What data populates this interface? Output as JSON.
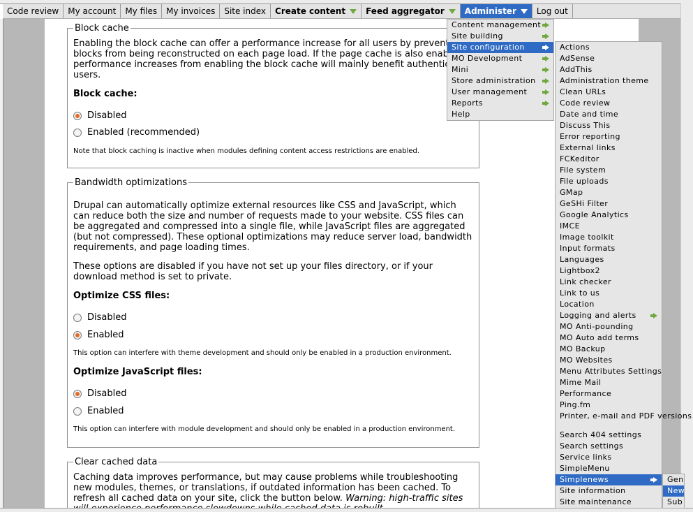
{
  "topbar": {
    "items": [
      {
        "label": "Code review",
        "bold": false,
        "dropdown": false
      },
      {
        "label": "My account",
        "bold": false,
        "dropdown": false
      },
      {
        "label": "My files",
        "bold": false,
        "dropdown": false
      },
      {
        "label": "My invoices",
        "bold": false,
        "dropdown": false
      },
      {
        "label": "Site index",
        "bold": false,
        "dropdown": false
      },
      {
        "label": "Create content",
        "bold": true,
        "dropdown": true
      },
      {
        "label": "Feed aggregator",
        "bold": true,
        "dropdown": true
      },
      {
        "label": "Administer",
        "bold": true,
        "dropdown": true,
        "active": true
      },
      {
        "label": "Log out",
        "bold": false,
        "dropdown": false
      }
    ]
  },
  "block_cache": {
    "legend": "Block cache",
    "description": "Enabling the block cache can offer a performance increase for all users by preventing blocks from being reconstructed on each page load. If the page cache is also enabled, performance increases from enabling the block cache will mainly benefit authenticated users.",
    "field_label": "Block cache:",
    "options": [
      "Disabled",
      "Enabled (recommended)"
    ],
    "selected": "Disabled",
    "note": "Note that block caching is inactive when modules defining content access restrictions are enabled."
  },
  "bandwidth": {
    "legend": "Bandwidth optimizations",
    "description1": "Drupal can automatically optimize external resources like CSS and JavaScript, which can reduce both the size and number of requests made to your website. CSS files can be aggregated and compressed into a single file, while JavaScript files are aggregated (but not compressed). These optional optimizations may reduce server load, bandwidth requirements, and page loading times.",
    "description2": "These options are disabled if you have not set up your files directory, or if your download method is set to private.",
    "css_label": "Optimize CSS files:",
    "css_options": [
      "Disabled",
      "Enabled"
    ],
    "css_selected": "Enabled",
    "css_note": "This option can interfere with theme development and should only be enabled in a production environment.",
    "js_label": "Optimize JavaScript files:",
    "js_options": [
      "Disabled",
      "Enabled"
    ],
    "js_selected": "Disabled",
    "js_note": "This option can interfere with module development and should only be enabled in a production environment."
  },
  "clear_cache": {
    "legend": "Clear cached data",
    "description": "Caching data improves performance, but may cause problems while troubleshooting new modules, themes, or translations, if outdated information has been cached. To refresh all cached data on your site, click the button below.",
    "warning": "Warning: high-traffic sites will experience performance slowdowns while cached data is rebuilt."
  },
  "admin_menu": {
    "items": [
      {
        "label": "Content management",
        "submenu": true
      },
      {
        "label": "Site building",
        "submenu": true
      },
      {
        "label": "Site configuration",
        "submenu": true,
        "selected": true
      },
      {
        "label": "MO Development",
        "submenu": true
      },
      {
        "label": "Mini",
        "submenu": true
      },
      {
        "label": "Store administration",
        "submenu": true
      },
      {
        "label": "User management",
        "submenu": true
      },
      {
        "label": "Reports",
        "submenu": true
      },
      {
        "label": "Help",
        "submenu": false
      }
    ]
  },
  "config_menu": {
    "items": [
      {
        "label": "Actions"
      },
      {
        "label": "AdSense"
      },
      {
        "label": "AddThis"
      },
      {
        "label": "Administration theme"
      },
      {
        "label": "Clean URLs"
      },
      {
        "label": "Code review"
      },
      {
        "label": "Date and time"
      },
      {
        "label": "Discuss This"
      },
      {
        "label": "Error reporting"
      },
      {
        "label": "External links"
      },
      {
        "label": "FCKeditor"
      },
      {
        "label": "File system"
      },
      {
        "label": "File uploads"
      },
      {
        "label": "GMap"
      },
      {
        "label": "GeSHi Filter"
      },
      {
        "label": "Google Analytics"
      },
      {
        "label": "IMCE"
      },
      {
        "label": "Image toolkit"
      },
      {
        "label": "Input formats"
      },
      {
        "label": "Languages"
      },
      {
        "label": "Lightbox2"
      },
      {
        "label": "Link checker"
      },
      {
        "label": "Link to us"
      },
      {
        "label": "Location"
      },
      {
        "label": "Logging and alerts",
        "submenu": true
      },
      {
        "label": "MO Anti-pounding"
      },
      {
        "label": "MO Auto add terms"
      },
      {
        "label": "MO Backup"
      },
      {
        "label": "MO Websites"
      },
      {
        "label": "Menu Attributes Settings"
      },
      {
        "label": "Mime Mail"
      },
      {
        "label": "Performance"
      },
      {
        "label": "Ping.fm"
      },
      {
        "label": "Printer, e-mail and PDF versions",
        "two_line": true
      },
      {
        "label": "Search 404 settings"
      },
      {
        "label": "Search settings"
      },
      {
        "label": "Service links"
      },
      {
        "label": "SimpleMenu"
      },
      {
        "label": "Simplenews",
        "submenu": true,
        "selected": true
      },
      {
        "label": "Site information"
      },
      {
        "label": "Site maintenance"
      }
    ]
  },
  "simplenews_menu": {
    "items": [
      {
        "label": "Gen"
      },
      {
        "label": "New",
        "selected": true
      },
      {
        "label": "Sub"
      }
    ]
  }
}
